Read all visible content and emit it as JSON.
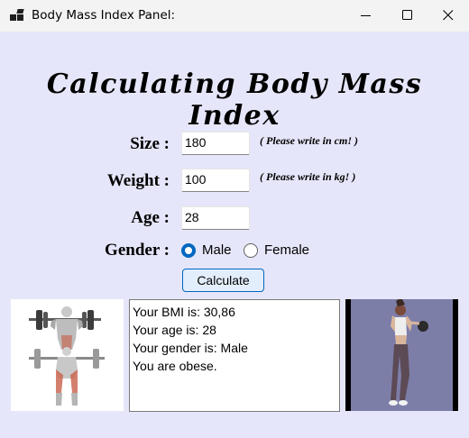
{
  "window": {
    "title": "Body Mass Index Panel:"
  },
  "heading": "Calculating Body Mass Index",
  "form": {
    "size_label": "Size :",
    "size_value": "180",
    "size_hint": "( Please write in cm! )",
    "weight_label": "Weight :",
    "weight_value": "100",
    "weight_hint": "( Please write in kg! )",
    "age_label": "Age :",
    "age_value": "28",
    "gender_label": "Gender :",
    "gender_options": [
      "Male",
      "Female"
    ],
    "gender_selected": "Male",
    "calculate_label": "Calculate"
  },
  "result_lines": [
    "Your BMI is: 30,86",
    "Your age is: 28",
    "Your gender is: Male",
    "You are obese."
  ],
  "colors": {
    "background": "#e6e6fa",
    "accent": "#0067c0",
    "button_fill": "#e3eefc"
  }
}
